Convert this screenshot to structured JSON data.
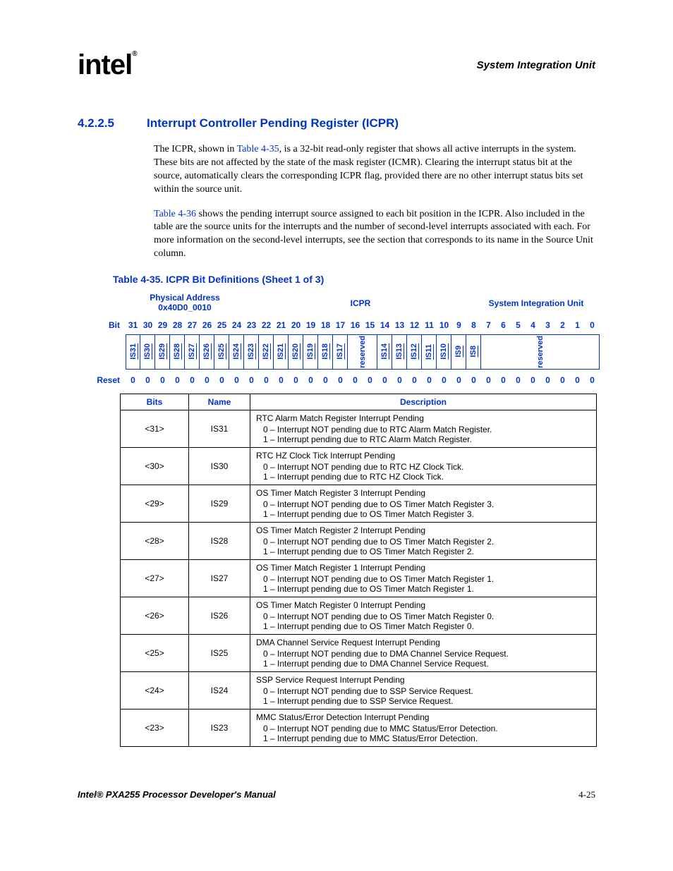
{
  "header": {
    "logo_text": "intel",
    "reg_mark": "®",
    "doc_section": "System Integration Unit"
  },
  "heading": {
    "number": "4.2.2.5",
    "title": "Interrupt Controller Pending Register (ICPR)"
  },
  "paragraphs": {
    "p1_pre": "The ICPR, shown in ",
    "p1_link": "Table 4-35",
    "p1_post": ", is a 32-bit read-only register that shows all active interrupts in the system. These bits are not affected by the state of the mask register (ICMR). Clearing the interrupt status bit at the source, automatically clears the corresponding ICPR flag, provided there are no other interrupt status bits set within the source unit.",
    "p2_link": "Table 4-36",
    "p2_post": " shows the pending interrupt source assigned to each bit position in the ICPR. Also included in the table are the source units for the interrupts and the number of second-level interrupts associated with each. For more information on the second-level interrupts, see the section that corresponds to its name in the Source Unit column."
  },
  "table_caption": "Table 4-35. ICPR Bit Definitions (Sheet 1 of 3)",
  "reg_header": {
    "phys_label": "Physical Address",
    "phys_value": "0x40D0_0010",
    "center": "ICPR",
    "right": "System Integration Unit"
  },
  "row_labels": {
    "bit": "Bit",
    "reset": "Reset"
  },
  "bit_numbers": [
    "31",
    "30",
    "29",
    "28",
    "27",
    "26",
    "25",
    "24",
    "23",
    "22",
    "21",
    "20",
    "19",
    "18",
    "17",
    "16",
    "15",
    "14",
    "13",
    "12",
    "11",
    "10",
    "9",
    "8",
    "7",
    "6",
    "5",
    "4",
    "3",
    "2",
    "1",
    "0"
  ],
  "bit_names": [
    "IS31",
    "IS30",
    "IS29",
    "IS28",
    "IS27",
    "IS26",
    "IS25",
    "IS24",
    "IS23",
    "IS22",
    "IS21",
    "IS20",
    "IS19",
    "IS18",
    "IS17",
    "reserved",
    "IS14",
    "IS13",
    "IS12",
    "IS11",
    "IS10",
    "IS9",
    "IS8",
    "reserved"
  ],
  "reset_values": [
    "0",
    "0",
    "0",
    "0",
    "0",
    "0",
    "0",
    "0",
    "0",
    "0",
    "0",
    "0",
    "0",
    "0",
    "0",
    "0",
    "0",
    "0",
    "0",
    "0",
    "0",
    "0",
    "0",
    "0",
    "0",
    "0",
    "0",
    "0",
    "0",
    "0",
    "0",
    "0"
  ],
  "desc_headers": {
    "bits": "Bits",
    "name": "Name",
    "desc": "Description"
  },
  "chart_data": {
    "type": "table",
    "title": "ICPR Bit Definitions",
    "columns": [
      "Bits",
      "Name",
      "Description"
    ],
    "rows": [
      {
        "bits": "<31>",
        "name": "IS31",
        "title": "RTC Alarm Match Register Interrupt Pending",
        "l0": "0 – Interrupt NOT pending due to RTC Alarm Match Register.",
        "l1": "1 – Interrupt pending due to RTC Alarm Match Register."
      },
      {
        "bits": "<30>",
        "name": "IS30",
        "title": "RTC HZ Clock Tick Interrupt Pending",
        "l0": "0 – Interrupt NOT pending due to RTC HZ Clock Tick.",
        "l1": "1 – Interrupt pending due to RTC HZ Clock Tick."
      },
      {
        "bits": "<29>",
        "name": "IS29",
        "title": "OS Timer Match Register 3 Interrupt Pending",
        "l0": "0 – Interrupt NOT pending due to OS Timer Match Register 3.",
        "l1": "1 – Interrupt pending due to OS Timer Match Register 3."
      },
      {
        "bits": "<28>",
        "name": "IS28",
        "title": "OS Timer Match Register 2 Interrupt Pending",
        "l0": "0 – Interrupt NOT pending due to OS Timer Match Register 2.",
        "l1": "1 – Interrupt pending due to OS Timer Match Register 2."
      },
      {
        "bits": "<27>",
        "name": "IS27",
        "title": "OS Timer Match Register 1 Interrupt Pending",
        "l0": "0 – Interrupt NOT pending due to OS Timer Match Register 1.",
        "l1": "1 – Interrupt pending due to OS Timer Match Register 1."
      },
      {
        "bits": "<26>",
        "name": "IS26",
        "title": "OS Timer Match Register 0 Interrupt Pending",
        "l0": "0 – Interrupt NOT pending due to OS Timer Match Register 0.",
        "l1": "1 – Interrupt pending due to OS Timer Match Register 0."
      },
      {
        "bits": "<25>",
        "name": "IS25",
        "title": "DMA Channel Service Request Interrupt Pending",
        "l0": "0 – Interrupt NOT pending due to DMA Channel Service Request.",
        "l1": "1 – Interrupt pending due to DMA Channel Service Request."
      },
      {
        "bits": "<24>",
        "name": "IS24",
        "title": "SSP Service Request Interrupt Pending",
        "l0": "0 – Interrupt NOT pending due to SSP Service Request.",
        "l1": "1 – Interrupt pending due to SSP Service Request."
      },
      {
        "bits": "<23>",
        "name": "IS23",
        "title": "MMC Status/Error Detection Interrupt Pending",
        "l0": "0 – Interrupt NOT pending due to MMC Status/Error Detection.",
        "l1": "1 – Interrupt pending due to MMC Status/Error Detection."
      }
    ]
  },
  "footer": {
    "manual": "Intel® PXA255 Processor Developer's Manual",
    "page": "4-25"
  }
}
